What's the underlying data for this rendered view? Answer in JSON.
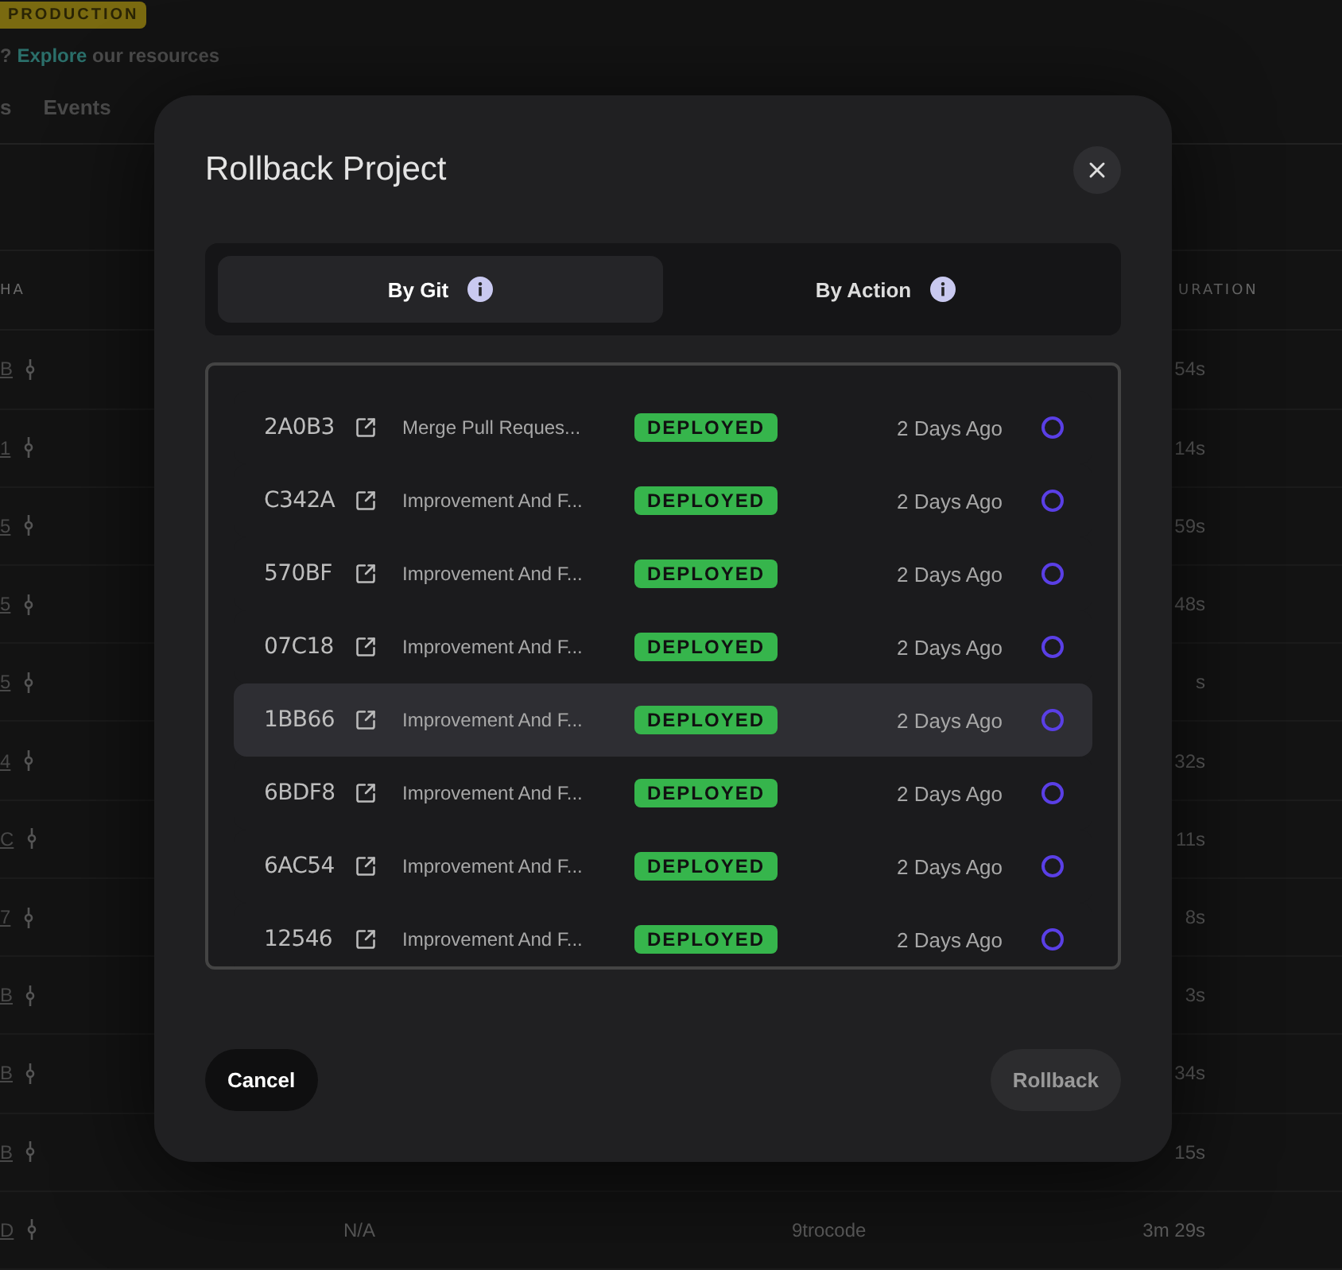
{
  "environment_badge": "PRODUCTION",
  "help": {
    "prefix": "?",
    "link": "Explore",
    "suffix": "our resources"
  },
  "nav_tabs": [
    {
      "label": "s",
      "selected": false
    },
    {
      "label": "Events",
      "selected": false
    }
  ],
  "table": {
    "columns": [
      "HA",
      "URATION"
    ],
    "rows": [
      {
        "sha": "B",
        "duration": "54s"
      },
      {
        "sha": "1",
        "duration": "14s"
      },
      {
        "sha": "5",
        "duration": "59s"
      },
      {
        "sha": "5",
        "duration": "48s"
      },
      {
        "sha": "5",
        "duration": "s"
      },
      {
        "sha": "4",
        "duration": "32s"
      },
      {
        "sha": "C",
        "duration": "11s"
      },
      {
        "sha": "7",
        "duration": "8s"
      },
      {
        "sha": "B",
        "duration": "3s"
      },
      {
        "sha": "B",
        "duration": "34s"
      },
      {
        "sha": "B",
        "duration": "15s"
      },
      {
        "sha": "D",
        "column_2": "N/A",
        "column_3": "9trocode",
        "duration": "3m 29s"
      }
    ]
  },
  "dialog": {
    "title": "Rollback Project",
    "tabs": [
      {
        "label": "By Git",
        "selected": true
      },
      {
        "label": "By Action",
        "selected": false
      }
    ],
    "commits": [
      {
        "sha": "2A0B3",
        "message": "Merge Pull Reques...",
        "status": "DEPLOYED",
        "time": "2 Days Ago",
        "hovered": false,
        "selected": false
      },
      {
        "sha": "C342A",
        "message": "Improvement And F...",
        "status": "DEPLOYED",
        "time": "2 Days Ago",
        "hovered": false,
        "selected": false
      },
      {
        "sha": "570BF",
        "message": "Improvement And F...",
        "status": "DEPLOYED",
        "time": "2 Days Ago",
        "hovered": false,
        "selected": false
      },
      {
        "sha": "07C18",
        "message": "Improvement And F...",
        "status": "DEPLOYED",
        "time": "2 Days Ago",
        "hovered": false,
        "selected": false
      },
      {
        "sha": "1BB66",
        "message": "Improvement And F...",
        "status": "DEPLOYED",
        "time": "2 Days Ago",
        "hovered": true,
        "selected": false
      },
      {
        "sha": "6BDF8",
        "message": "Improvement And F...",
        "status": "DEPLOYED",
        "time": "2 Days Ago",
        "hovered": false,
        "selected": false
      },
      {
        "sha": "6AC54",
        "message": "Improvement And F...",
        "status": "DEPLOYED",
        "time": "2 Days Ago",
        "hovered": false,
        "selected": false
      },
      {
        "sha": "12546",
        "message": "Improvement And F...",
        "status": "DEPLOYED",
        "time": "2 Days Ago",
        "hovered": false,
        "selected": false
      }
    ],
    "cancel": "Cancel",
    "confirm": {
      "label": "Rollback",
      "disabled": true
    }
  }
}
